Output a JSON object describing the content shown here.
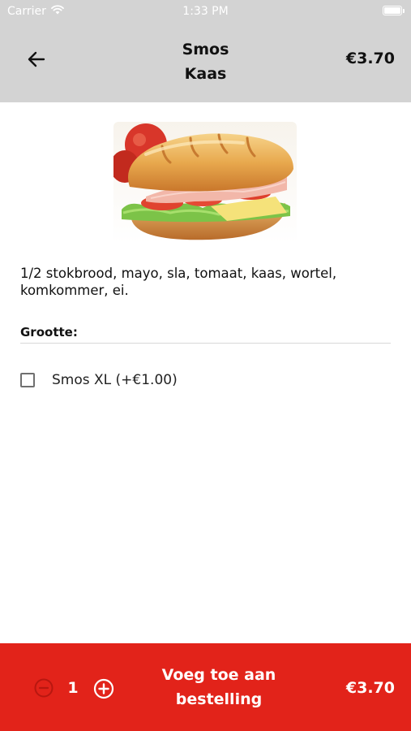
{
  "status_bar": {
    "carrier": "Carrier",
    "time": "1:33 PM",
    "wifi_icon": "wifi-icon",
    "battery_level": 1.0
  },
  "header": {
    "back_icon": "arrow-left-icon",
    "title_line1": "Smos",
    "title_line2": "Kaas",
    "price": "€3.70"
  },
  "product": {
    "image": "sandwich-photo",
    "description": "1/2 stokbrood, mayo, sla, tomaat, kaas, wortel, komkommer, ei."
  },
  "options": {
    "section_label": "Grootte:",
    "items": [
      {
        "label": "Smos XL (+€1.00)",
        "checked": false
      }
    ]
  },
  "footer": {
    "minus_icon": "minus-circle-icon",
    "quantity": "1",
    "plus_icon": "plus-circle-icon",
    "add_line1": "Voeg toe aan",
    "add_line2": "bestelling",
    "price": "€3.70",
    "background_color": "#e2231a"
  },
  "colors": {
    "header_bg": "#d3d3d3",
    "accent": "#e2231a"
  }
}
